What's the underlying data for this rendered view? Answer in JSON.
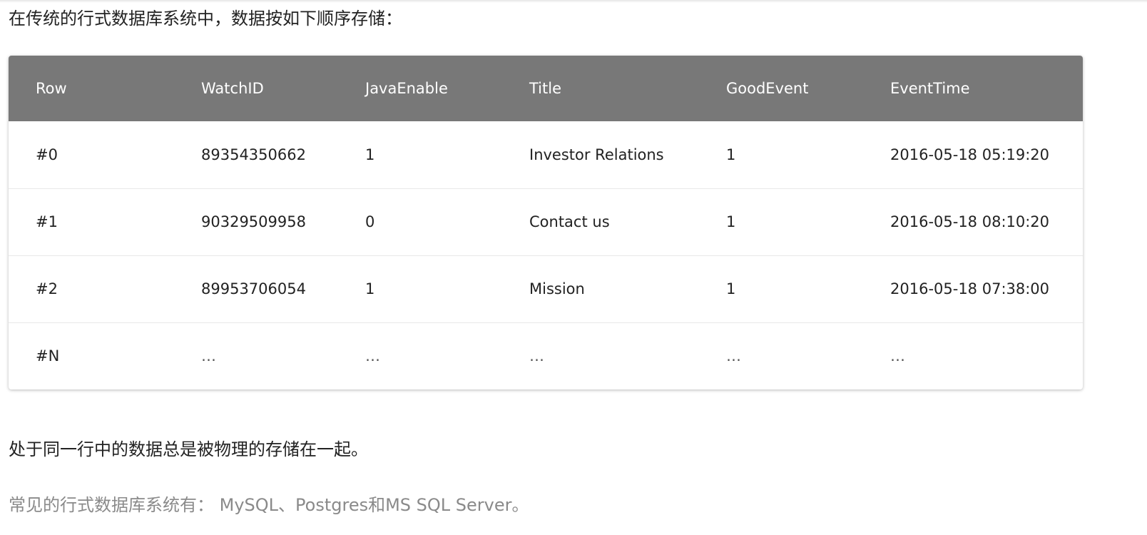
{
  "intro_text": "在传统的行式数据库系统中，数据按如下顺序存储：",
  "table": {
    "columns": [
      "Row",
      "WatchID",
      "JavaEnable",
      "Title",
      "GoodEvent",
      "EventTime"
    ],
    "rows": [
      [
        "#0",
        "89354350662",
        "1",
        "Investor Relations",
        "1",
        "2016-05-18 05:19:20"
      ],
      [
        "#1",
        "90329509958",
        "0",
        "Contact us",
        "1",
        "2016-05-18 08:10:20"
      ],
      [
        "#2",
        "89953706054",
        "1",
        "Mission",
        "1",
        "2016-05-18 07:38:00"
      ],
      [
        "#N",
        "…",
        "…",
        "…",
        "…",
        "…"
      ]
    ],
    "header_color": "#787878"
  },
  "paragraph": "处于同一行中的数据总是被物理的存储在一起。",
  "note": "常见的行式数据库系统有： MySQL、Postgres和MS SQL Server。"
}
